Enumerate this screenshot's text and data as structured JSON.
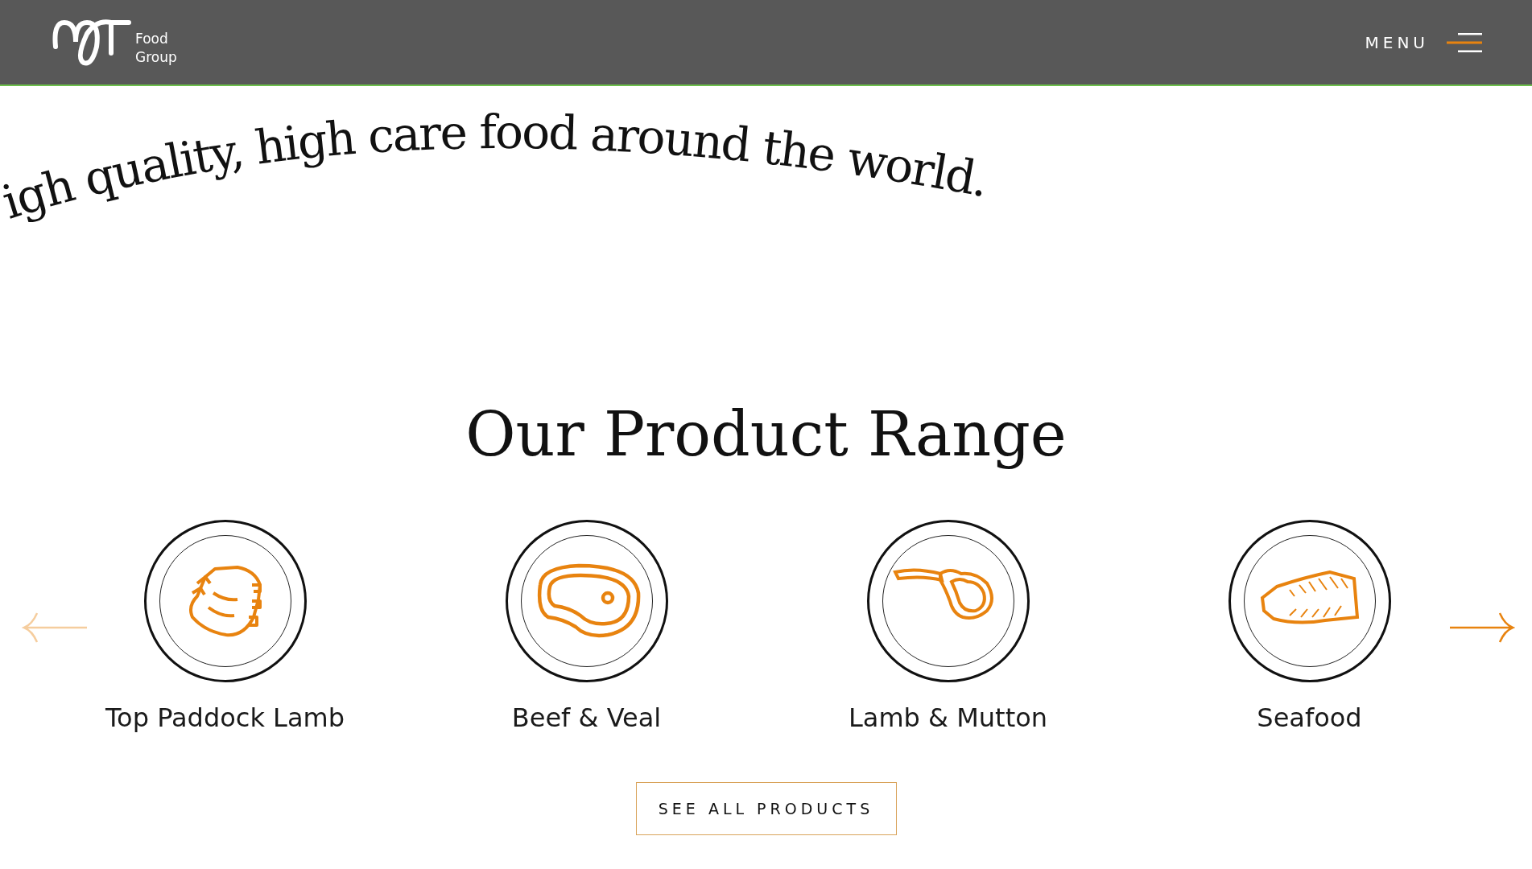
{
  "header": {
    "logo_text": [
      "Food",
      "Group"
    ],
    "menu_label": "MENU"
  },
  "tagline": "igh quality, high care food around the world.",
  "section": {
    "title": "Our Product Range",
    "products": [
      {
        "kind": "lamb",
        "name": "Top Paddock Lamb"
      },
      {
        "kind": "beef",
        "name": "Beef & Veal"
      },
      {
        "kind": "chop",
        "name": "Lamb & Mutton"
      },
      {
        "kind": "fish",
        "name": "Seafood"
      }
    ],
    "arrows": [
      {
        "kind": "previous",
        "disabled": true
      },
      {
        "kind": "next",
        "disabled": false
      }
    ],
    "button": "SEE ALL PRODUCTS"
  }
}
